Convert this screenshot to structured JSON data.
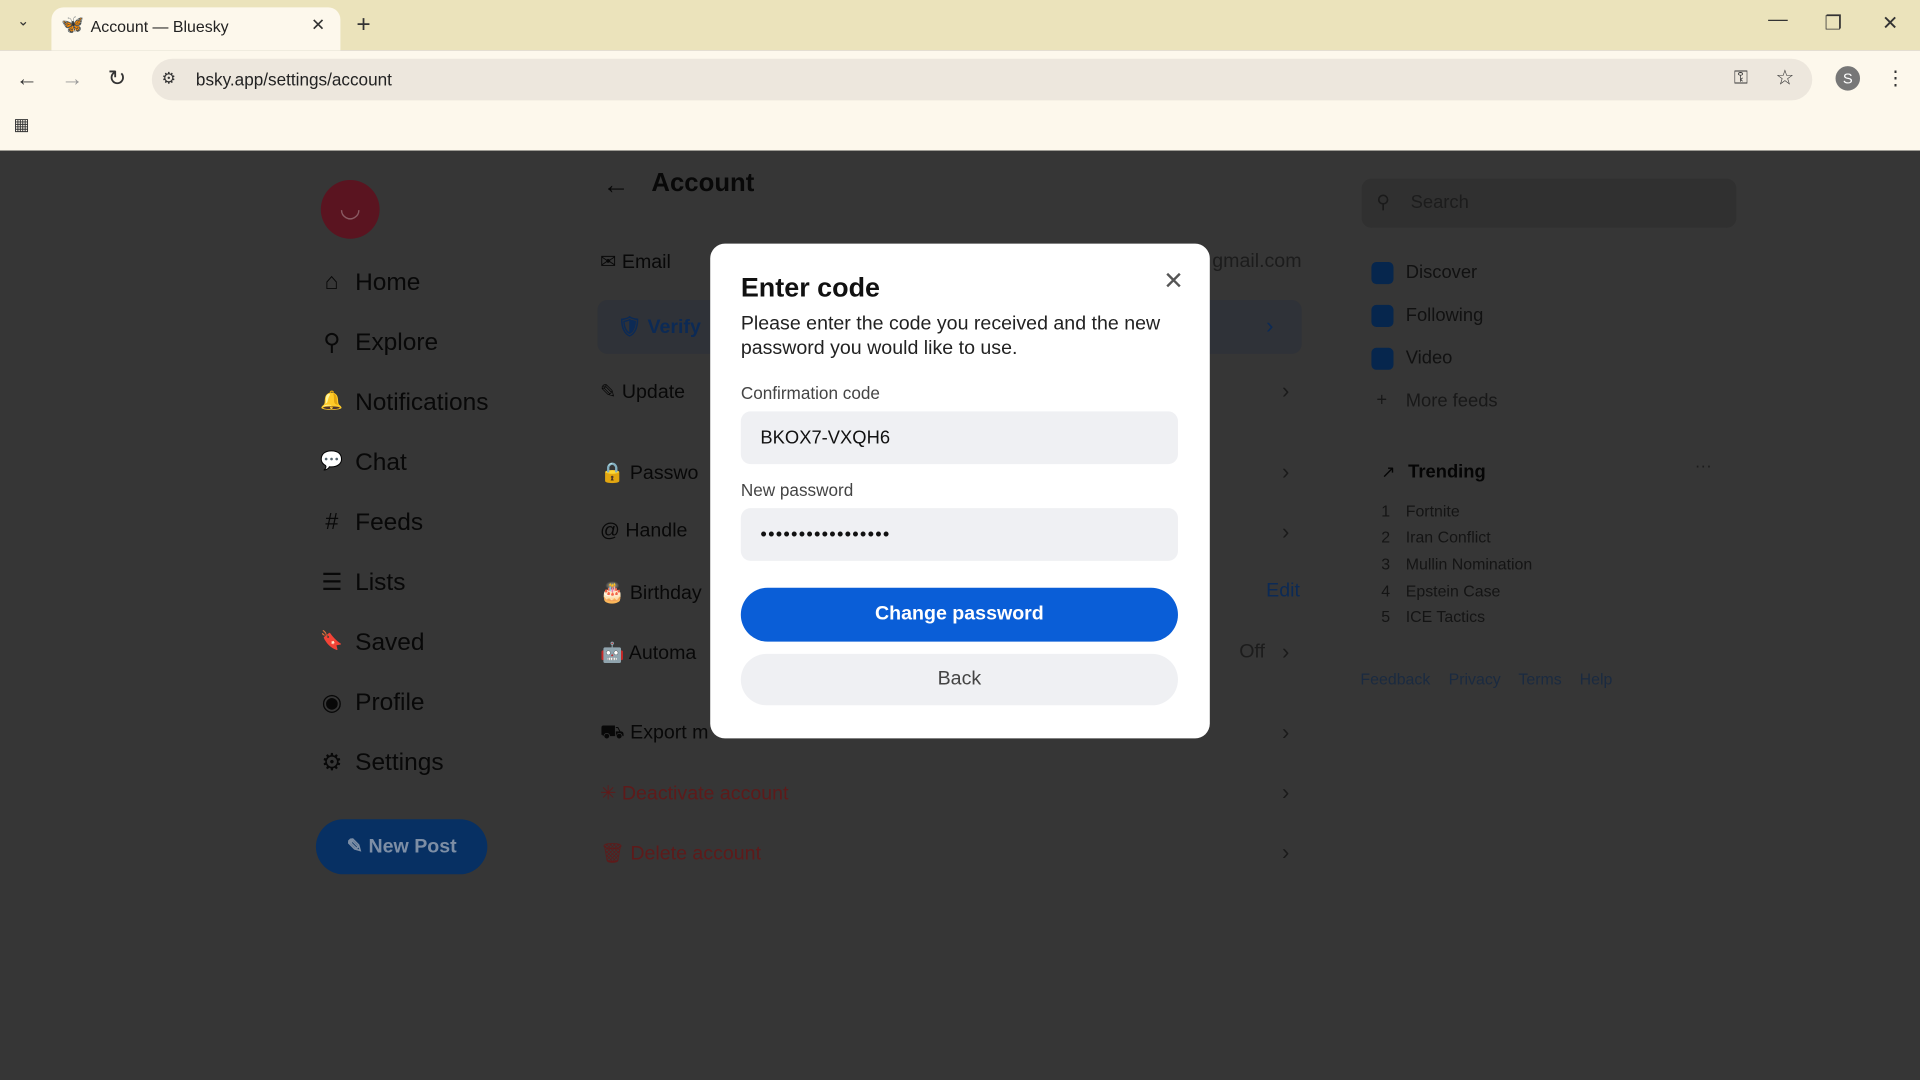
{
  "browser": {
    "tab_title": "Account — Bluesky",
    "url": "bsky.app/settings/account",
    "profile_initial": "S"
  },
  "sidebar": {
    "items": [
      {
        "label": "Home",
        "icon": "⌂"
      },
      {
        "label": "Explore",
        "icon": "⚲"
      },
      {
        "label": "Notifications",
        "icon": "🔔"
      },
      {
        "label": "Chat",
        "icon": "💬"
      },
      {
        "label": "Feeds",
        "icon": "#"
      },
      {
        "label": "Lists",
        "icon": "☰"
      },
      {
        "label": "Saved",
        "icon": "🔖"
      },
      {
        "label": "Profile",
        "icon": "◉"
      },
      {
        "label": "Settings",
        "icon": "⚙"
      }
    ],
    "new_post": "New Post"
  },
  "account": {
    "title": "Account",
    "rows": [
      {
        "label": "Email",
        "value": "gmail.com",
        "icon": "✉"
      },
      {
        "label": "Verify",
        "icon": "🛡"
      },
      {
        "label": "Update",
        "icon": "✎"
      },
      {
        "label": "Passwo",
        "icon": "🔒"
      },
      {
        "label": "Handle",
        "icon": "@"
      },
      {
        "label": "Birthday",
        "value": "Edit",
        "icon": "🎂"
      },
      {
        "label": "Automa",
        "value": "Off",
        "icon": "🤖"
      },
      {
        "label": "Export m",
        "icon": "⛟"
      },
      {
        "label": "Deactivate account",
        "icon": "✳"
      },
      {
        "label": "Delete account",
        "icon": "🗑"
      }
    ]
  },
  "right": {
    "search_placeholder": "Search",
    "feeds": [
      "Discover",
      "Following",
      "Video",
      "More feeds"
    ],
    "trending_title": "Trending",
    "trending": [
      "Fortnite",
      "Iran Conflict",
      "Mullin Nomination",
      "Epstein Case",
      "ICE Tactics"
    ],
    "footer": [
      "Feedback",
      "Privacy",
      "Terms",
      "Help"
    ]
  },
  "modal": {
    "title": "Enter code",
    "description": "Please enter the code you received and the new password you would like to use.",
    "code_label": "Confirmation code",
    "code_value": "BKOX7-VXQH6",
    "password_label": "New password",
    "password_value": "•••••••••••••••••",
    "primary": "Change password",
    "secondary": "Back"
  },
  "colors": {
    "accent": "#0a5ed7",
    "danger": "#d32f2f"
  }
}
